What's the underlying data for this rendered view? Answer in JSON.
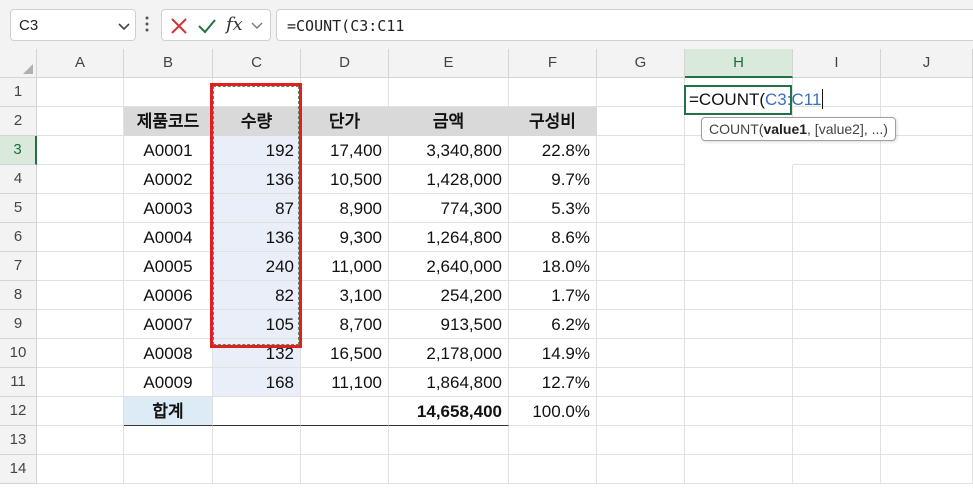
{
  "name_box": {
    "value": "C3"
  },
  "formula_bar": {
    "value": "=COUNT(C3:C11",
    "fx_label": "fx"
  },
  "columns": [
    "A",
    "B",
    "C",
    "D",
    "E",
    "F",
    "G",
    "H",
    "I",
    "J"
  ],
  "rows": [
    "1",
    "2",
    "3",
    "4",
    "5",
    "6",
    "7",
    "8",
    "9",
    "10",
    "11",
    "12",
    "13",
    "14"
  ],
  "table": {
    "headers": [
      "제품코드",
      "수량",
      "단가",
      "금액",
      "구성비"
    ],
    "rows": [
      [
        "A0001",
        "192",
        "17,400",
        "3,340,800",
        "22.8%"
      ],
      [
        "A0002",
        "136",
        "10,500",
        "1,428,000",
        "9.7%"
      ],
      [
        "A0003",
        "87",
        "8,900",
        "774,300",
        "5.3%"
      ],
      [
        "A0004",
        "136",
        "9,300",
        "1,264,800",
        "8.6%"
      ],
      [
        "A0005",
        "240",
        "11,000",
        "2,640,000",
        "18.0%"
      ],
      [
        "A0006",
        "82",
        "3,100",
        "254,200",
        "1.7%"
      ],
      [
        "A0007",
        "105",
        "8,700",
        "913,500",
        "6.2%"
      ],
      [
        "A0008",
        "132",
        "16,500",
        "2,178,000",
        "14.9%"
      ],
      [
        "A0009",
        "168",
        "11,100",
        "1,864,800",
        "12.7%"
      ]
    ],
    "total_label": "합계",
    "total_amount": "14,658,400",
    "total_ratio": "100.0%"
  },
  "edit_cell": {
    "prefix": "=COUNT(",
    "ref": "C3:C11"
  },
  "tooltip": {
    "func": "COUNT(",
    "arg1": "value1",
    "rest": ", [value2], ...)"
  },
  "colors": {
    "accent": "#217346",
    "highlight_red": "#e02020",
    "range_ref": "#3a6fc4",
    "cancel": "#d13438"
  }
}
